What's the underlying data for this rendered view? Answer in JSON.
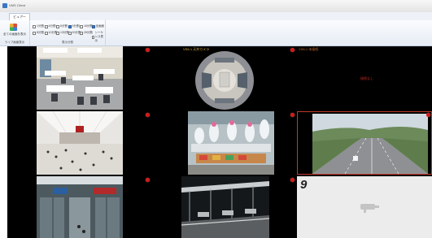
{
  "window": {
    "title": "VMS Client"
  },
  "ribbon": {
    "tab": "ビュアー",
    "big_button_label": "全ての画面を表示",
    "group1_label": "ライブ画面表示",
    "group2_label": "表示分割",
    "checkboxes_row1": [
      {
        "label": "1分割",
        "checked": false
      },
      {
        "label": "4分割",
        "checked": false
      },
      {
        "label": "6分割",
        "checked": false
      },
      {
        "label": "9分割",
        "checked": true
      },
      {
        "label": "16分割",
        "checked": false
      },
      {
        "label": "全画面",
        "checked": true
      }
    ],
    "checkboxes_row2": [
      {
        "label": "8分割",
        "checked": false
      },
      {
        "label": "10分割",
        "checked": false
      },
      {
        "label": "13分割",
        "checked": false
      },
      {
        "label": "20分割",
        "checked": false
      },
      {
        "label": "25分割",
        "checked": false
      },
      {
        "label": "シーケンス表示",
        "checked": false
      }
    ]
  },
  "cells": [
    {
      "id": 1,
      "label": "",
      "content": "office"
    },
    {
      "id": 2,
      "label": "VS6-1 天井カメラ",
      "content": "fisheye"
    },
    {
      "id": 3,
      "label": "VS6-1 未接続",
      "content": "nosignal",
      "center_text": "接続なし"
    },
    {
      "id": 4,
      "label": "",
      "content": "concourse"
    },
    {
      "id": 5,
      "label": "",
      "content": "factory"
    },
    {
      "id": 6,
      "label": "",
      "content": "highway"
    },
    {
      "id": 7,
      "label": "",
      "content": "station"
    },
    {
      "id": 8,
      "label": "",
      "content": "platform"
    },
    {
      "id": 9,
      "label": "9",
      "content": "empty"
    }
  ],
  "colors": {
    "status_dot": "#d21a1a",
    "selected_border": "#c0392b"
  }
}
